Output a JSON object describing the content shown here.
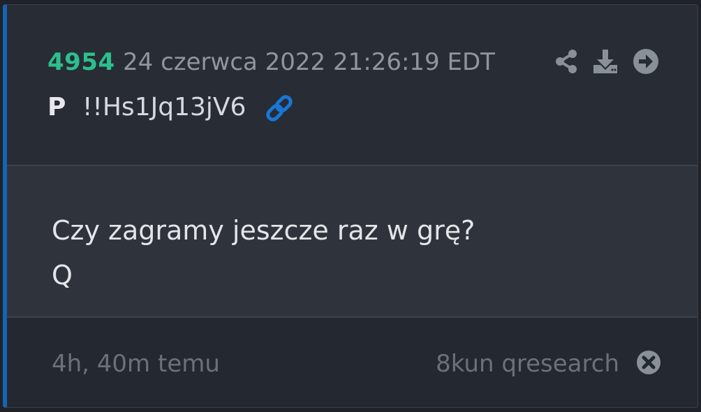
{
  "post": {
    "number": "4954",
    "timestamp": "24 czerwca 2022 21:26:19 EDT",
    "author": "P",
    "tripcode": "!!Hs1Jq13jV6"
  },
  "message": {
    "lines": [
      "Czy zagramy jeszcze raz w grę?",
      "Q"
    ]
  },
  "footer": {
    "relative_time": "4h, 40m temu",
    "source": "8kun qresearch"
  },
  "icons": {
    "share": "share-icon",
    "download": "download-icon",
    "open": "arrow-right-circle-icon",
    "link": "link-icon",
    "close": "close-circle-icon"
  },
  "colors": {
    "accent_border": "#1465b3",
    "post_number": "#2cbf8d",
    "link_icon": "#1877d6",
    "card_bg": "#282c35"
  }
}
